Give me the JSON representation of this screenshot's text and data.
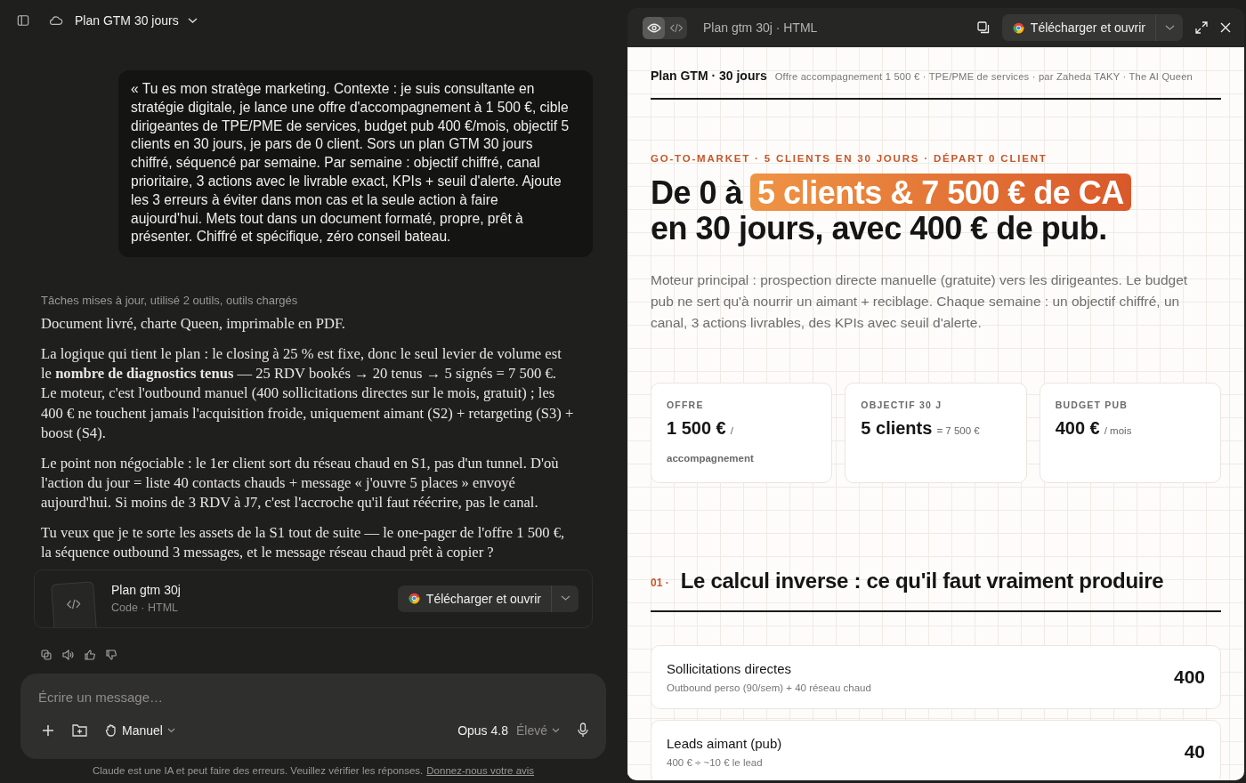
{
  "chat": {
    "title": "Plan GTM 30 jours",
    "user_message": "« Tu es mon stratège marketing. Contexte : je suis consultante en stratégie digitale, je lance une offre d'accompagnement à 1 500 €, cible dirigeantes de TPE/PME de services, budget pub 400 €/mois, objectif 5 clients en 30 jours, je pars de 0 client. Sors un plan GTM 30 jours chiffré, séquencé par semaine. Par semaine : objectif chiffré, canal prioritaire, 3 actions avec le livrable exact, KPIs + seuil d'alerte. Ajoute les 3 erreurs à éviter dans mon cas et la seule action à faire aujourd'hui. Mets tout dans un document formaté, propre, prêt à présenter. Chiffré et spécifique, zéro conseil bateau.",
    "status": "Tâches mises à jour, utilisé 2 outils, outils chargés",
    "paragraphs": [
      "Document livré, charte Queen, imprimable en PDF.",
      "La logique qui tient le plan : le closing à 25 % est fixe, donc le seul levier de volume est le **nombre de diagnostics tenus** — 25 RDV bookés → 20 tenus → 5 signés = 7 500 €. Le moteur, c'est l'outbound manuel (400 sollicitations directes sur le mois, gratuit) ; les 400 € ne touchent jamais l'acquisition froide, uniquement aimant (S2) + retargeting (S3) + boost (S4).",
      "Le point non négociable : le 1er client sort du réseau chaud en S1, pas d'un tunnel. D'où l'action du jour = liste 40 contacts chauds + message « j'ouvre 5 places » envoyé aujourd'hui. Si moins de 3 RDV à J7, c'est l'accroche qu'il faut réécrire, pas le canal.",
      "Tu veux que je te sorte les assets de la S1 tout de suite — le one-pager de l'offre 1 500 €, la séquence outbound 3 messages, et le message réseau chaud prêt à copier ?"
    ],
    "artifact": {
      "name": "Plan gtm 30j",
      "meta": "Code · HTML",
      "button": "Télécharger et ouvrir"
    },
    "composer": {
      "placeholder": "Écrire un message…",
      "mode": "Manuel",
      "model": "Opus 4.8",
      "effort": "Élevé"
    },
    "disclaimer": "Claude est une IA et peut faire des erreurs. Veuillez vérifier les réponses.",
    "feedback_link": "Donnez-nous votre avis"
  },
  "preview": {
    "tabs": [
      {
        "kind": "preview",
        "selected": true
      },
      {
        "kind": "code",
        "selected": false
      }
    ],
    "title": "Plan gtm 30j · HTML",
    "button": "Télécharger et ouvrir",
    "doc": {
      "brand": "Plan GTM · 30 jours",
      "byline": "Offre accompagnement 1 500 € · TPE/PME de services · par Zaheda TAKY · The AI Queen",
      "eyebrow": "GO-TO-MARKET · 5 CLIENTS EN 30 JOURS · DÉPART 0 CLIENT",
      "title_lines": [
        [
          {
            "text": "De 0 à",
            "highlight": false
          },
          {
            "text": "5 clients & 7 500 € de CA",
            "highlight": true
          }
        ],
        [
          {
            "text": "en 30 jours, avec 400 € de pub.",
            "highlight": false
          }
        ]
      ],
      "lead": "Moteur principal : prospection directe manuelle (gratuite) vers les dirigeantes. Le budget pub ne sert qu'à nourrir un aimant + reciblage. Chaque semaine : un objectif chiffré, un canal, 3 actions livrables, des KPIs avec seuil d'alerte.",
      "cards": [
        {
          "label": "OFFRE",
          "value": "1 500 €",
          "unit": "/",
          "note": "accompagnement"
        },
        {
          "label": "OBJECTIF 30 J",
          "value": "5 clients",
          "unit": "= 7 500 €"
        },
        {
          "label": "BUDGET PUB",
          "value": "400 €",
          "unit": "/ mois"
        }
      ],
      "section": {
        "number": "01 ·",
        "title": "Le calcul inverse : ce qu'il faut vraiment produire"
      },
      "rows": [
        {
          "title": "Sollicitations directes",
          "detail": "Outbound perso (90/sem) + 40 réseau chaud",
          "value": "400"
        },
        {
          "title": "Leads aimant (pub)",
          "detail": "400 € ÷ ~10 € le lead",
          "value": "40"
        }
      ]
    }
  }
}
